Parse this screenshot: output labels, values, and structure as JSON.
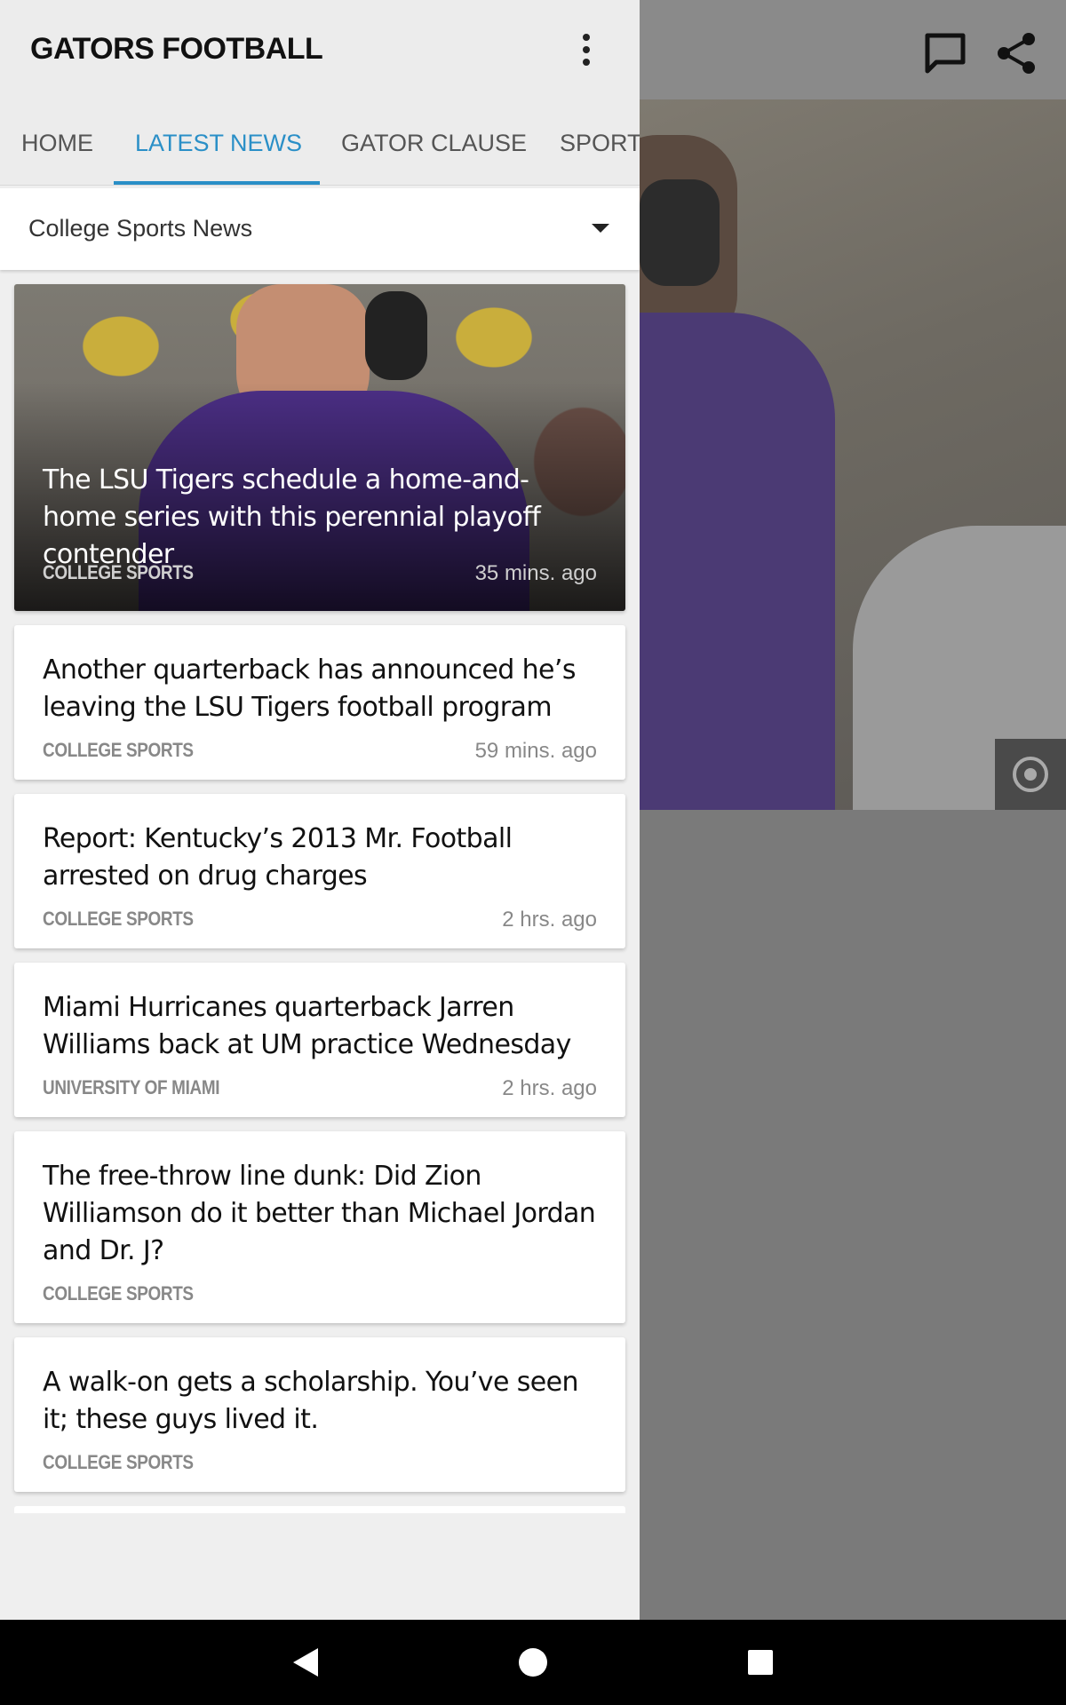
{
  "app": {
    "title": "GATORS FOOTBALL"
  },
  "tabs": [
    {
      "label": "HOME",
      "active": false
    },
    {
      "label": "LATEST NEWS",
      "active": true
    },
    {
      "label": "GATOR CLAUSE",
      "active": false
    },
    {
      "label": "SPORT",
      "active": false
    }
  ],
  "filter": {
    "selected": "College Sports News"
  },
  "articles": [
    {
      "title": "The LSU Tigers schedule a home-and-home series with this perennial playoff contender",
      "source": "COLLEGE SPORTS",
      "time": "35 mins. ago"
    },
    {
      "title": "Another quarterback has announced he’s leaving the LSU Tigers football program",
      "source": "COLLEGE SPORTS",
      "time": "59 mins. ago"
    },
    {
      "title": "Report: Kentucky’s 2013 Mr. Football arrested on drug charges",
      "source": "COLLEGE SPORTS",
      "time": "2 hrs. ago"
    },
    {
      "title": "Miami Hurricanes quarterback Jarren Williams back at UM practice Wednesday",
      "source": "UNIVERSITY OF MIAMI",
      "time": "2 hrs. ago"
    },
    {
      "title": "The free-throw line dunk: Did Zion Williamson do it better than Michael Jordan and Dr. J?",
      "source": "COLLEGE SPORTS",
      "time": ""
    },
    {
      "title": "A walk-on gets a scholarship. You’ve seen it; these guys lived it.",
      "source": "COLLEGE SPORTS",
      "time": ""
    }
  ],
  "colors": {
    "accent": "#2a8fc7",
    "drawer_bg": "#efefef",
    "nav_bg": "#000000"
  },
  "icons": {
    "comment": "comment-icon",
    "share": "share-icon",
    "camera": "camera-icon",
    "overflow": "more-vert-icon"
  }
}
